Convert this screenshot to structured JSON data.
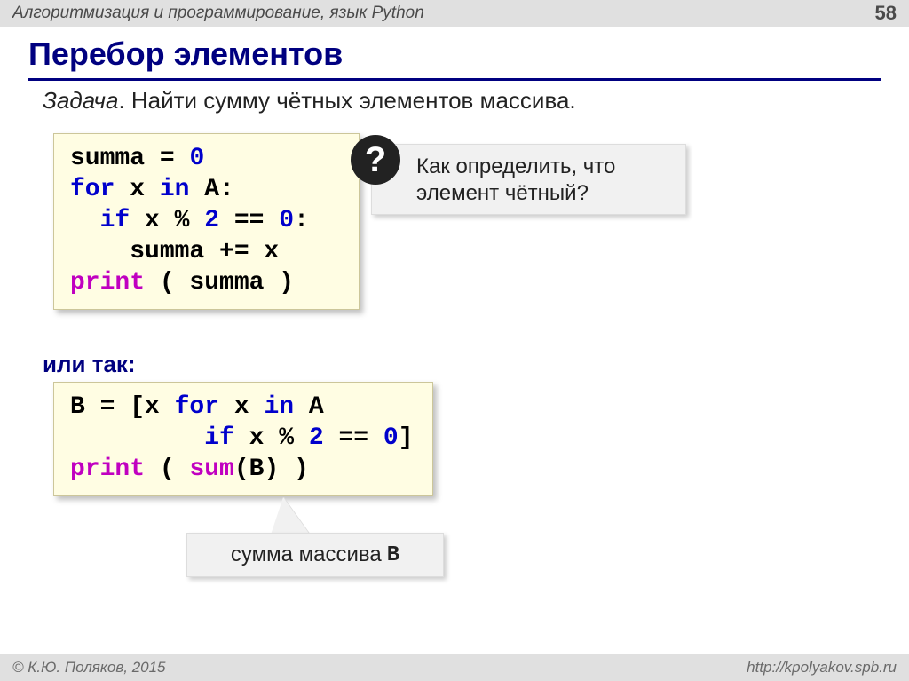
{
  "header": {
    "title": "Алгоритмизация и программирование, язык Python",
    "page": "58"
  },
  "title": "Перебор элементов",
  "task_label": "Задача",
  "task_text": ". Найти сумму чётных элементов массива.",
  "code1": {
    "l1a": "summa",
    "l1b": " = ",
    "l1c": "0",
    "l2a": "for",
    "l2b": " x ",
    "l2c": "in",
    "l2d": " A:",
    "l3a": "  ",
    "l3b": "if",
    "l3c": " x % ",
    "l3d": "2",
    "l3e": " == ",
    "l3f": "0",
    "l3g": ":",
    "l4": "    summa += x",
    "l5a": "print",
    "l5b": " ( summa )"
  },
  "question": {
    "icon": "?",
    "text": "Как определить, что элемент чётный?"
  },
  "or_label": "или так:",
  "code2": {
    "l1a": "B = [x ",
    "l1b": "for",
    "l1c": " x ",
    "l1d": "in",
    "l1e": " A",
    "l2a": "         ",
    "l2b": "if",
    "l2c": " x % ",
    "l2d": "2",
    "l2e": " == ",
    "l2f": "0",
    "l2g": "]",
    "l3a": "print",
    "l3b": " ( ",
    "l3c": "sum",
    "l3d": "(B) )"
  },
  "callout": {
    "text": "сумма массива",
    "mono": "B"
  },
  "footer": {
    "left": "© К.Ю. Поляков, 2015",
    "right": "http://kpolyakov.spb.ru"
  }
}
